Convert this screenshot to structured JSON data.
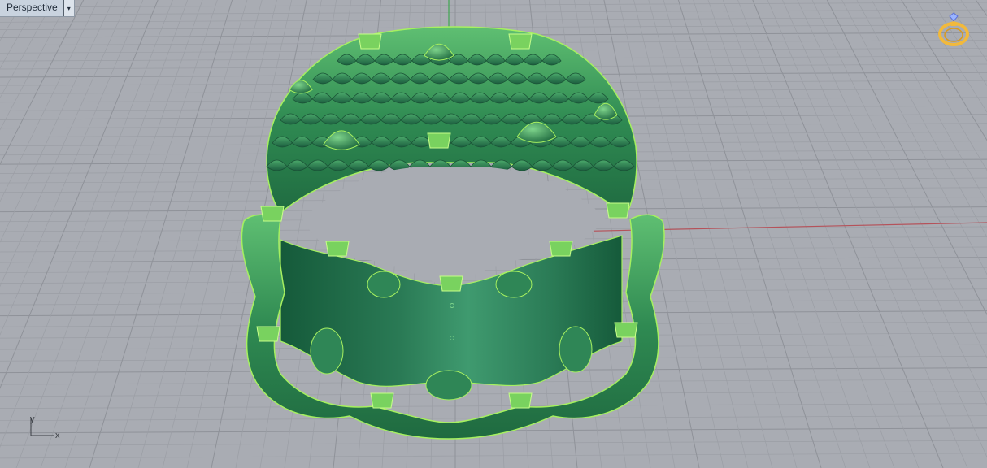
{
  "viewport": {
    "name": "Perspective",
    "dropdown_glyph": "▾"
  },
  "axis_widget": {
    "y_label": "y",
    "x_label": "x"
  },
  "icons": {
    "plugin_icon": "ring-with-gem-icon"
  },
  "colors": {
    "background": "#a9acb3",
    "grid_minor": "#9b9ea5",
    "grid_major": "#8f9299",
    "x_axis": "#b5525a",
    "y_axis": "#3fa750",
    "ring_dark": "#1f6a45",
    "ring_mid": "#3a8c5a",
    "ring_light": "#6cc47e",
    "selection_edge": "#a6f060",
    "icon_gold": "#f2b93b"
  }
}
